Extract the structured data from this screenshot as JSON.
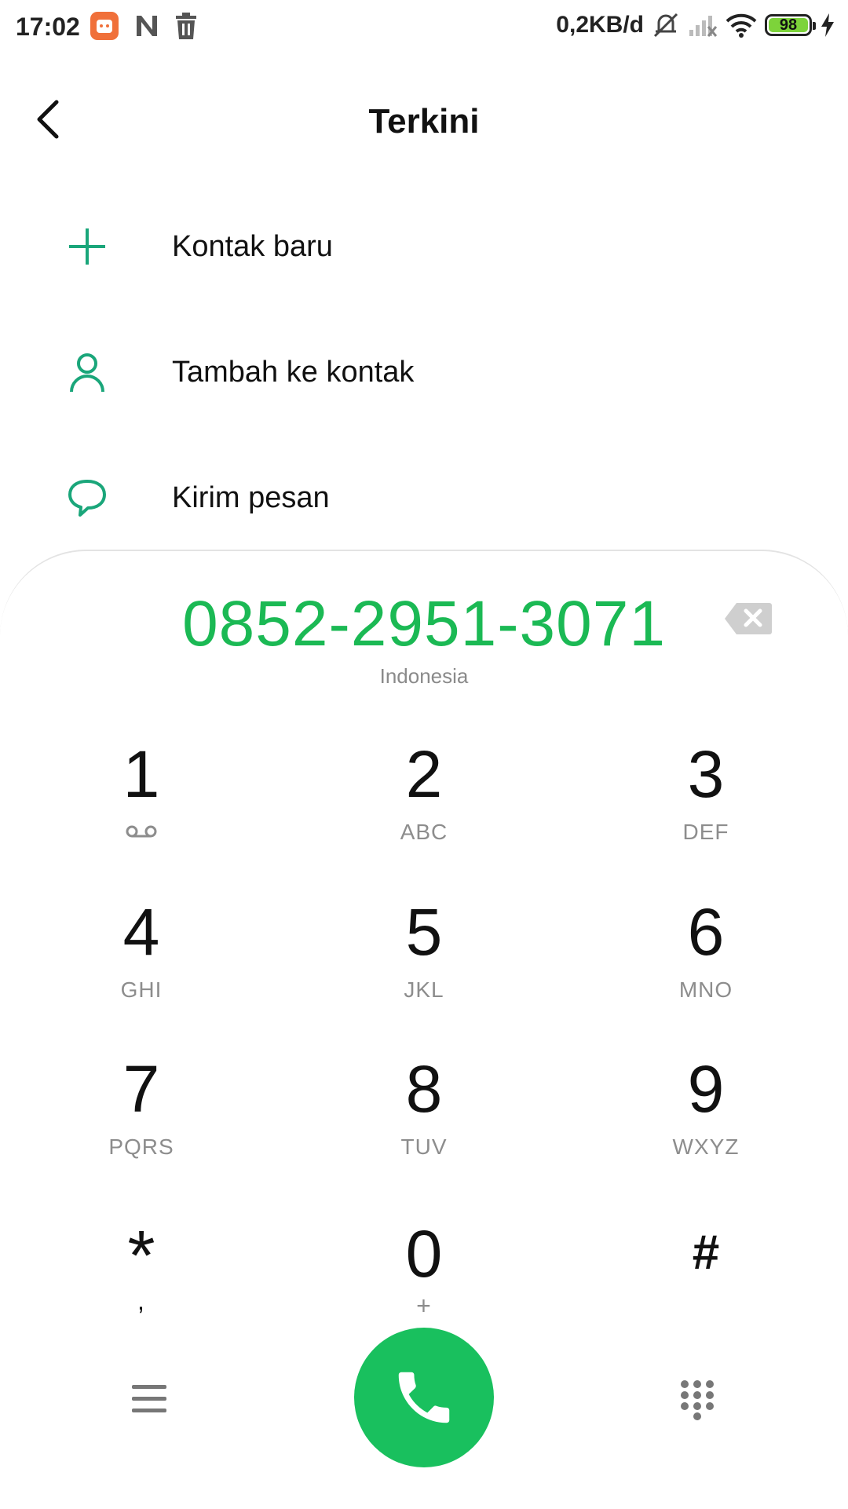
{
  "status_bar": {
    "time": "17:02",
    "net_speed": "0,2KB/d",
    "battery": "98",
    "icons": [
      "mi-app-icon",
      "n-icon",
      "trash-icon",
      "mute-icon",
      "signal-icon",
      "wifi-icon",
      "battery-icon",
      "charging-icon"
    ]
  },
  "header": {
    "title": "Terkini"
  },
  "options": [
    {
      "label": "Kontak baru",
      "icon": "plus-icon"
    },
    {
      "label": "Tambah ke kontak",
      "icon": "person-icon"
    },
    {
      "label": "Kirim pesan",
      "icon": "message-icon"
    }
  ],
  "dialer": {
    "number": "0852-2951-3071",
    "region": "Indonesia",
    "keys": [
      {
        "digit": "1",
        "letters": ""
      },
      {
        "digit": "2",
        "letters": "ABC"
      },
      {
        "digit": "3",
        "letters": "DEF"
      },
      {
        "digit": "4",
        "letters": "GHI"
      },
      {
        "digit": "5",
        "letters": "JKL"
      },
      {
        "digit": "6",
        "letters": "MNO"
      },
      {
        "digit": "7",
        "letters": "PQRS"
      },
      {
        "digit": "8",
        "letters": "TUV"
      },
      {
        "digit": "9",
        "letters": "WXYZ"
      },
      {
        "digit": "*",
        "letters": ","
      },
      {
        "digit": "0",
        "letters": "+"
      },
      {
        "digit": "#",
        "letters": ""
      }
    ]
  },
  "colors": {
    "accent": "#1bb954",
    "call_button": "#19c05e",
    "icon_teal": "#1aa67a"
  }
}
